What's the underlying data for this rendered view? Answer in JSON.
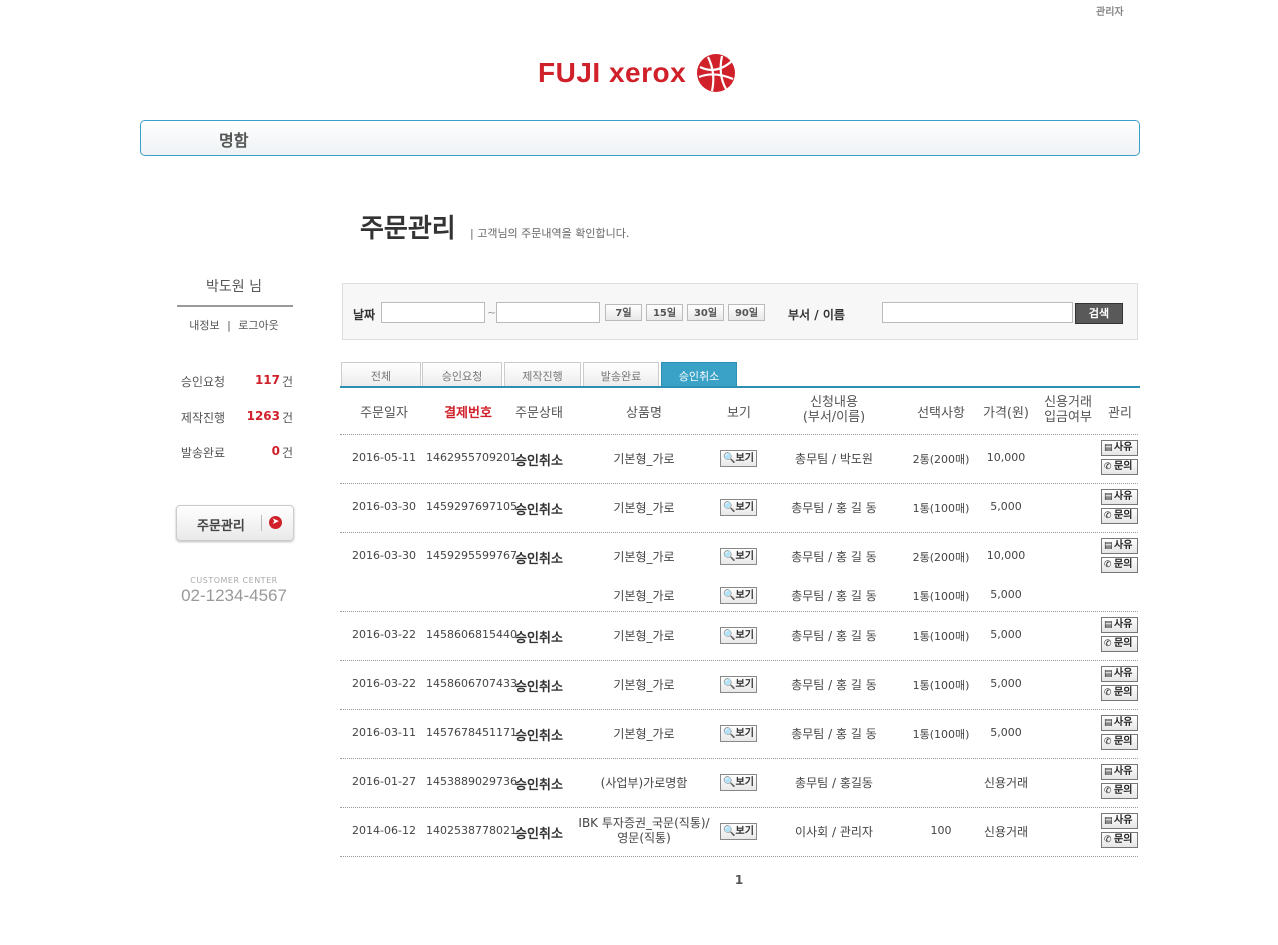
{
  "header": {
    "admin_link": "관리자",
    "logo_text": "FUJI xerox"
  },
  "category_bar": {
    "label": "명함"
  },
  "page": {
    "title": "주문관리",
    "subtitle": "| 고객님의 주문내역을 확인합니다."
  },
  "user": {
    "name": "박도원 님",
    "my_info": "내정보",
    "divider": "|",
    "logout": "로그아웃"
  },
  "stats": [
    {
      "label": "승인요청",
      "count": "117",
      "unit": "건"
    },
    {
      "label": "제작진행",
      "count": "1263",
      "unit": "건"
    },
    {
      "label": "발송완료",
      "count": "0",
      "unit": "건"
    }
  ],
  "order_button": {
    "label": "주문관리"
  },
  "customer_center": {
    "label": "CUSTOMER CENTER",
    "phone": "02-1234-4567"
  },
  "search": {
    "date_label": "날짜",
    "date_from": "",
    "date_to": "",
    "date_sep": "~",
    "days": [
      "7일",
      "15일",
      "30일",
      "90일"
    ],
    "dept_label": "부서 / 이름",
    "dept_value": "",
    "submit": "검색"
  },
  "tabs": [
    "전체",
    "승인요청",
    "제작진행",
    "발송완료",
    "승인취소"
  ],
  "active_tab": "승인취소",
  "columns": {
    "date": "주문일자",
    "payment": "결제번호",
    "status": "주문상태",
    "product": "상품명",
    "view": "보기",
    "request_1": "신청내용",
    "request_2": "(부서/이름)",
    "option": "선택사항",
    "price": "가격(원)",
    "credit_1": "신용거래",
    "credit_2": "입금여부",
    "manage": "관리"
  },
  "buttons": {
    "view": "보기",
    "reason": "사유",
    "inquiry": "문의"
  },
  "rows": [
    {
      "date": "2016-05-11",
      "payment": "1462955709201",
      "status": "승인취소",
      "product": "기본형_가로",
      "dept": "총무팀 / 박도원",
      "option": "2통(200매)",
      "price": "10,000"
    },
    {
      "date": "2016-03-30",
      "payment": "1459297697105",
      "status": "승인취소",
      "product": "기본형_가로",
      "dept": "총무팀 / 홍 길 동",
      "option": "1통(100매)",
      "price": "5,000"
    },
    {
      "date": "2016-03-30",
      "payment": "1459295599767",
      "status": "승인취소",
      "product": "기본형_가로",
      "dept": "총무팀 / 홍 길 동",
      "option": "2통(200매)",
      "price": "10,000"
    },
    {
      "date": "",
      "payment": "",
      "status": "",
      "product": "기본형_가로",
      "dept": "총무팀 / 홍 길 동",
      "option": "1통(100매)",
      "price": "5,000"
    },
    {
      "date": "2016-03-22",
      "payment": "1458606815440",
      "status": "승인취소",
      "product": "기본형_가로",
      "dept": "총무팀 / 홍 길 동",
      "option": "1통(100매)",
      "price": "5,000"
    },
    {
      "date": "2016-03-22",
      "payment": "1458606707433",
      "status": "승인취소",
      "product": "기본형_가로",
      "dept": "총무팀 / 홍 길 동",
      "option": "1통(100매)",
      "price": "5,000"
    },
    {
      "date": "2016-03-11",
      "payment": "1457678451171",
      "status": "승인취소",
      "product": "기본형_가로",
      "dept": "총무팀 / 홍 길 동",
      "option": "1통(100매)",
      "price": "5,000"
    },
    {
      "date": "2016-01-27",
      "payment": "1453889029736",
      "status": "승인취소",
      "product": "(사업부)가로명함",
      "dept": "총무팀 / 홍길동",
      "option": "",
      "price": "신용거래"
    },
    {
      "date": "2014-06-12",
      "payment": "1402538778021",
      "status": "승인취소",
      "product": "IBK 투자증권_국문(직통)/",
      "product_2": "영문(직통)",
      "dept": "이사회 / 관리자",
      "option": "100",
      "price": "신용거래"
    }
  ],
  "pagination": {
    "current": "1"
  }
}
